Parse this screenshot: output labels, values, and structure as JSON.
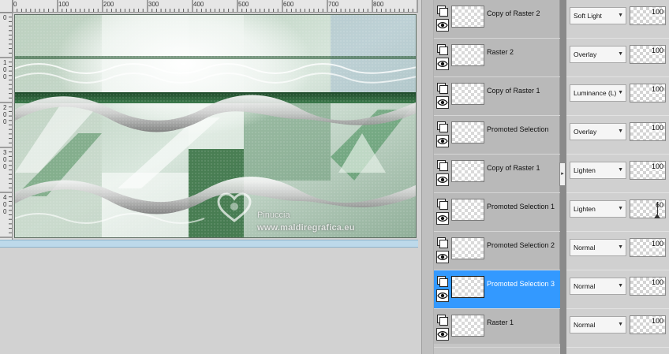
{
  "ruler": {
    "top_labels": [
      "0",
      "100",
      "200",
      "300",
      "400",
      "500",
      "600",
      "700",
      "800"
    ],
    "left_labels": [
      "0",
      "1\n0\n0",
      "2\n0\n0",
      "3\n0\n0",
      "4\n0\n0"
    ]
  },
  "watermark": {
    "name": "Pinuccia",
    "url": "www.maldiregrafica.eu"
  },
  "layers": [
    {
      "name": "Copy of Raster 2",
      "blend": "Soft Light",
      "opacity": "100",
      "selected": false
    },
    {
      "name": "Raster 2",
      "blend": "Overlay",
      "opacity": "100",
      "selected": false
    },
    {
      "name": "Copy of Raster 1",
      "blend": "Luminance (L)",
      "opacity": "100",
      "selected": false
    },
    {
      "name": "Promoted Selection",
      "blend": "Overlay",
      "opacity": "100",
      "selected": false
    },
    {
      "name": "Copy of Raster 1",
      "blend": "Lighten",
      "opacity": "100",
      "selected": false
    },
    {
      "name": "Promoted Selection 1",
      "blend": "Lighten",
      "opacity": "60",
      "selected": false
    },
    {
      "name": "Promoted Selection 2",
      "blend": "Normal",
      "opacity": "100",
      "selected": false
    },
    {
      "name": "Promoted Selection 3",
      "blend": "Normal",
      "opacity": "100",
      "selected": true
    },
    {
      "name": "Raster 1",
      "blend": "Normal",
      "opacity": "100",
      "selected": false
    }
  ],
  "icons": {
    "selection_toggle": "layer-selection-icon",
    "visibility": "eye-icon",
    "dropdown": "chevron-down-icon",
    "collapse": "chevron-right-icon"
  },
  "colors": {
    "selected_row": "#3399ff",
    "image_green": "#2f6b3b",
    "image_light": "#eef3ef"
  }
}
